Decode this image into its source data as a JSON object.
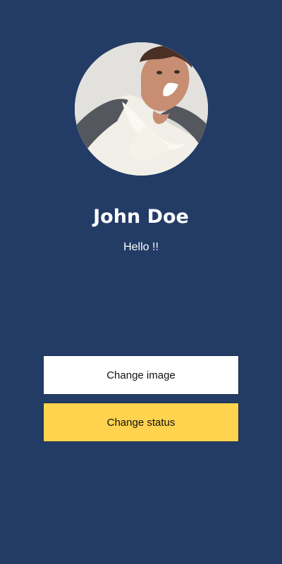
{
  "profile": {
    "name": "John Doe",
    "status": "Hello !!",
    "avatar_icon": "profile-photo"
  },
  "actions": {
    "change_image_label": "Change image",
    "change_status_label": "Change status"
  },
  "colors": {
    "background": "#223c66",
    "primary_button": "#ffffff",
    "secondary_button": "#ffd34d",
    "text_light": "#ffffff",
    "text_dark": "#111111"
  }
}
